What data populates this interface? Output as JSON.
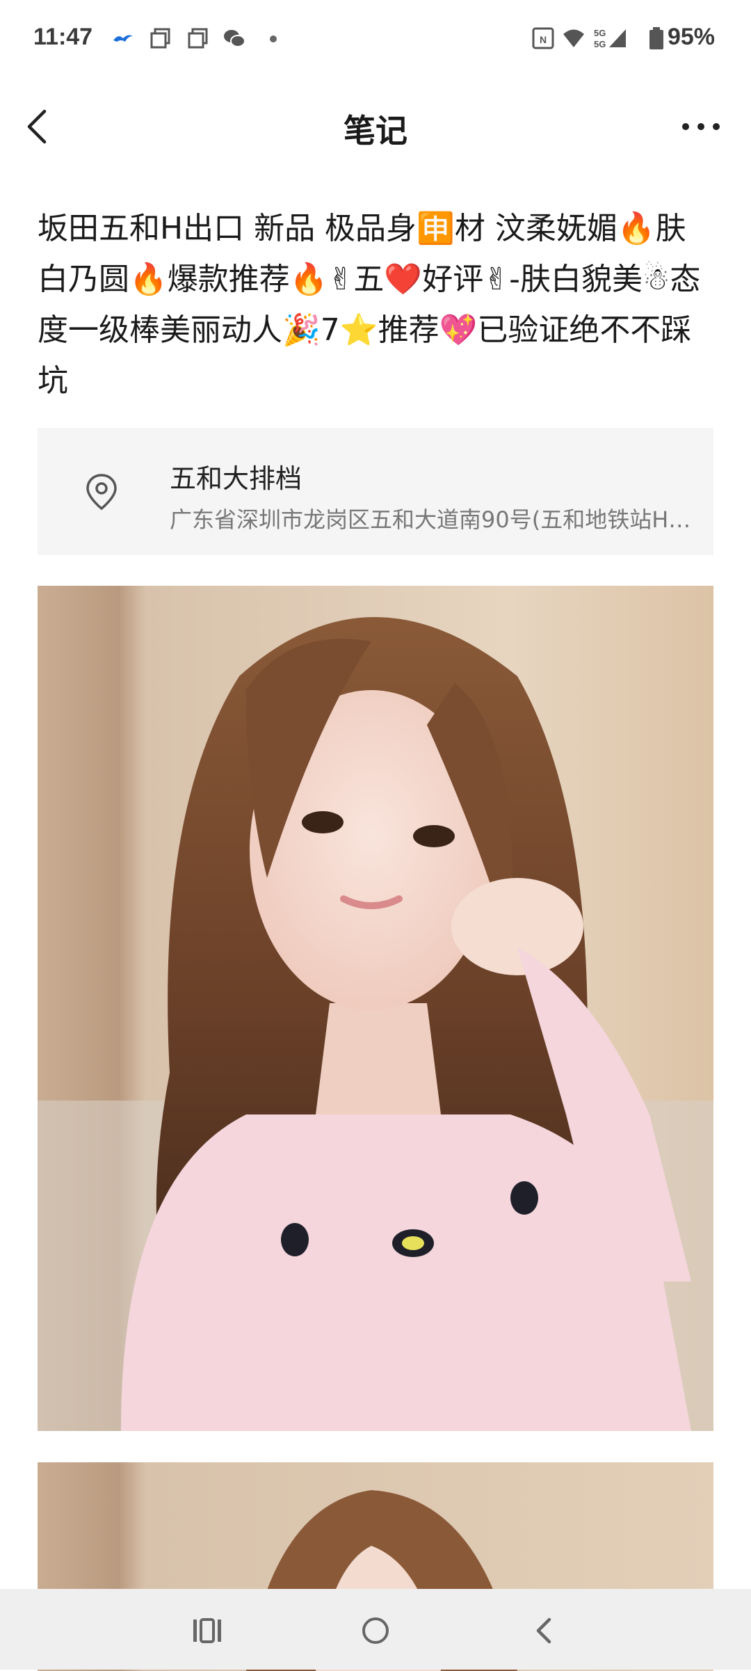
{
  "status_bar": {
    "time": "11:47",
    "battery": "95%",
    "icons": [
      "bird-icon",
      "copy-icon",
      "copy-icon",
      "wechat-icon",
      "dot-icon",
      "nfc-icon",
      "wifi-icon",
      "5g-signal-icon",
      "battery-icon"
    ]
  },
  "header": {
    "title": "笔记",
    "back_icon": "chevron-left-icon",
    "more_icon": "more-dots-icon"
  },
  "note": {
    "title": "坂田五和H出口 新品 极品身🈸材  汶柔妩媚🔥肤白乃圆🔥爆款推荐🔥✌五❤️好评✌-肤白貌美☃态度一级棒美丽动人🎉7⭐推荐💖已验证绝不不踩坑"
  },
  "location": {
    "name": "五和大排档",
    "address": "广东省深圳市龙岗区五和大道南90号(五和地铁站H…",
    "icon": "location-pin-icon"
  },
  "photos": [
    {
      "alt": "photo-1"
    },
    {
      "alt": "photo-2"
    }
  ],
  "nav": {
    "icons": [
      "recent-apps-icon",
      "home-icon",
      "back-icon"
    ]
  }
}
